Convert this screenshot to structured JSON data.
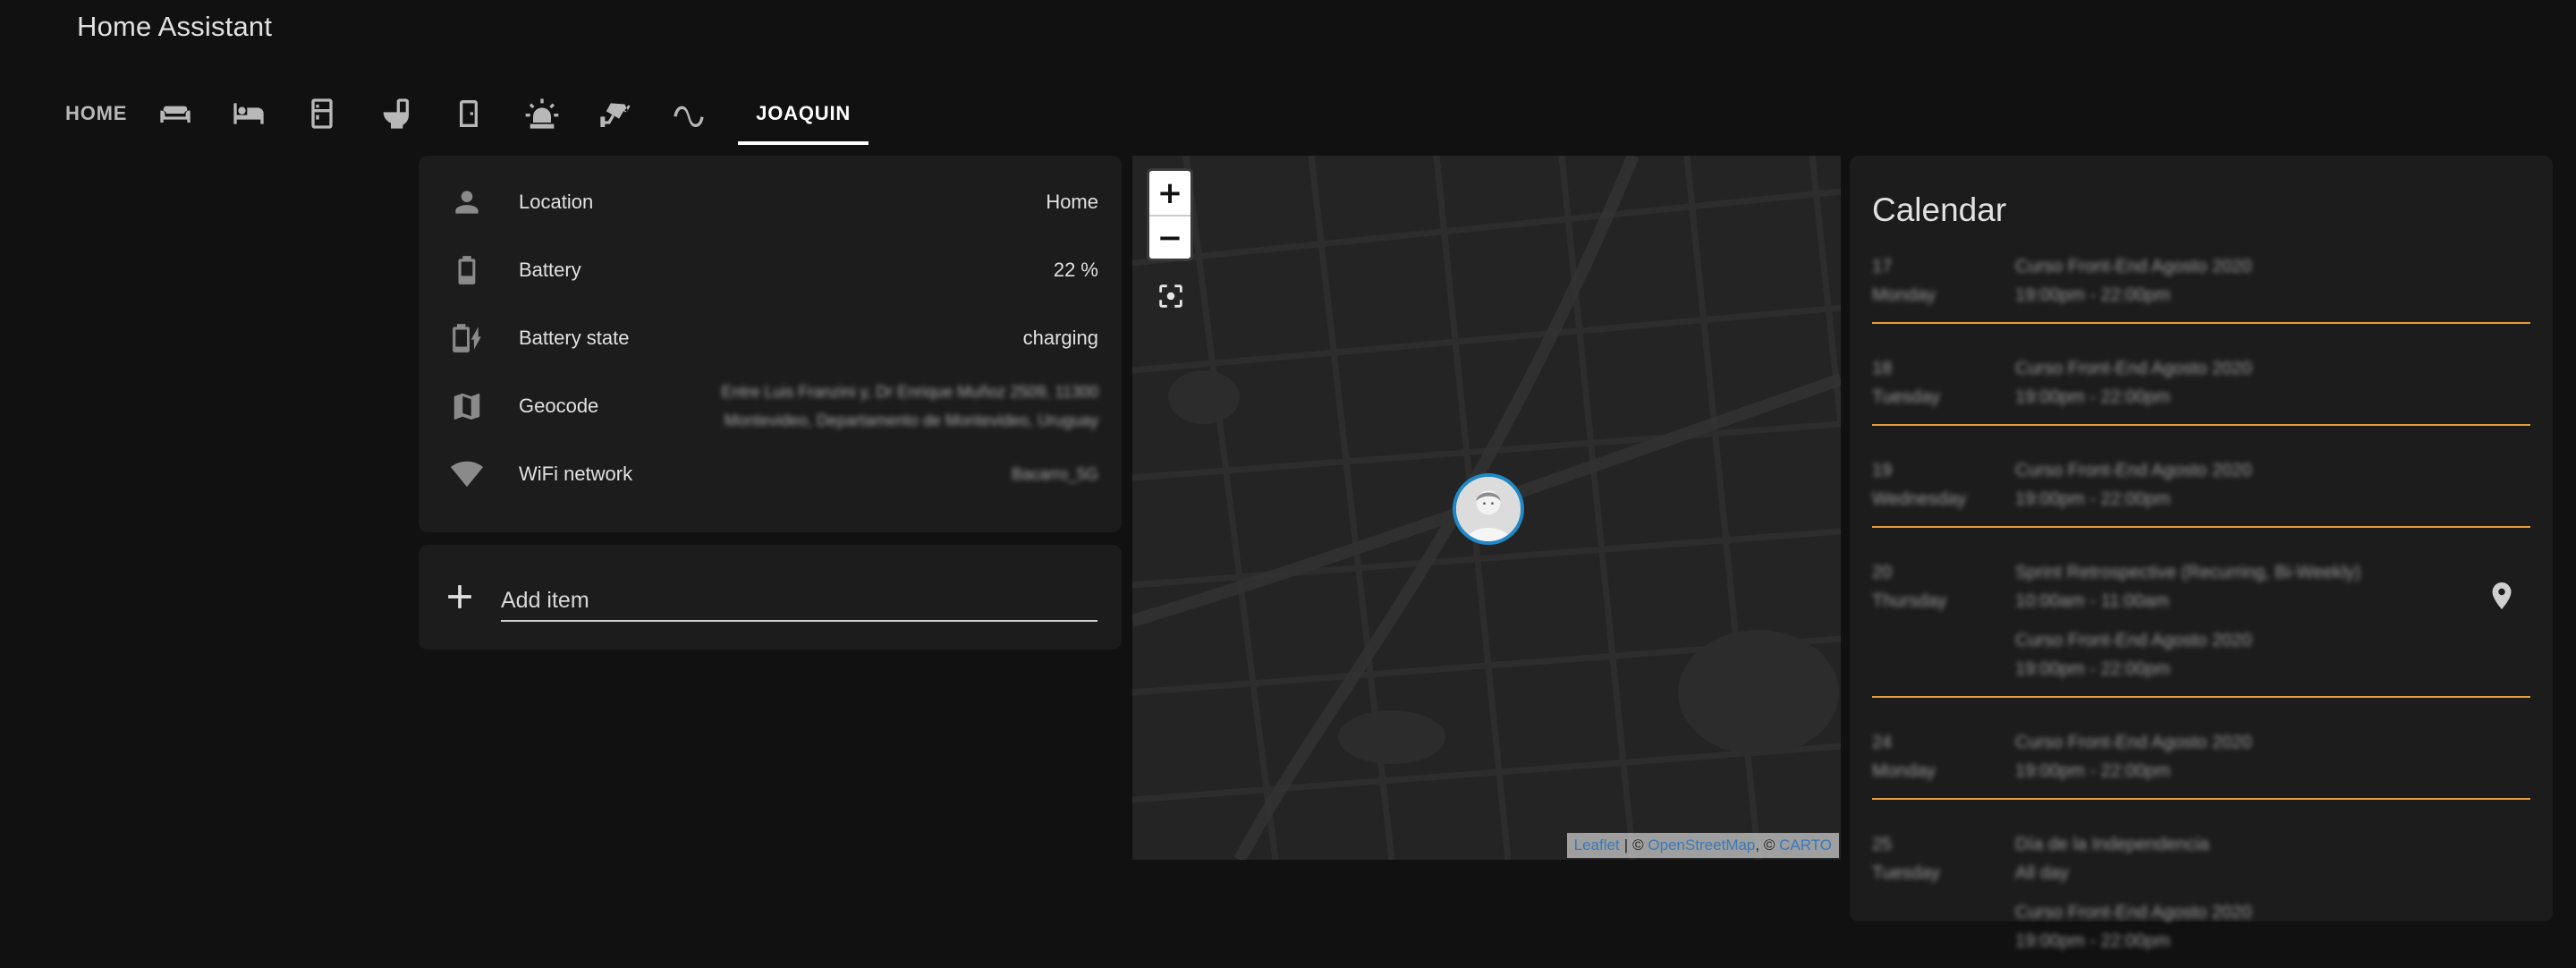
{
  "app": {
    "title": "Home Assistant"
  },
  "tabs": [
    {
      "label": "HOME",
      "type": "text"
    },
    {
      "icon": "sofa-icon",
      "type": "icon"
    },
    {
      "icon": "bed-icon",
      "type": "icon"
    },
    {
      "icon": "fridge-icon",
      "type": "icon"
    },
    {
      "icon": "toilet-icon",
      "type": "icon"
    },
    {
      "icon": "door-icon",
      "type": "icon"
    },
    {
      "icon": "alarm-light-icon",
      "type": "icon"
    },
    {
      "icon": "cctv-icon",
      "type": "icon"
    },
    {
      "icon": "sine-wave-icon",
      "type": "icon"
    },
    {
      "label": "JOAQUIN",
      "type": "text",
      "active": true
    }
  ],
  "entities": [
    {
      "icon": "account-icon",
      "name": "Location",
      "value": "Home"
    },
    {
      "icon": "battery-icon",
      "name": "Battery",
      "value": "22 %"
    },
    {
      "icon": "battery-charging-icon",
      "name": "Battery state",
      "value": "charging"
    },
    {
      "icon": "map-icon",
      "name": "Geocode",
      "value_line1": "Entre Luis Franzini y, Dr Enrique Muñoz 2509, 11300",
      "value_line2": "Montevideo, Departamento de Montevideo, Uruguay"
    },
    {
      "icon": "wifi-icon",
      "name": "WiFi network",
      "value": "Bacarro_5G"
    }
  ],
  "todo": {
    "placeholder": "Add item"
  },
  "map": {
    "zoom_in": "+",
    "zoom_out": "−",
    "attribution": {
      "leaflet": "Leaflet",
      "osm": "OpenStreetMap",
      "carto": "CARTO",
      "copyright": "©",
      "separator": "|"
    }
  },
  "calendar": {
    "title": "Calendar",
    "days": [
      {
        "day": "17",
        "weekday": "Monday",
        "events": [
          {
            "title": "Curso Front-End Agosto 2020",
            "time": "19:00pm - 22:00pm"
          }
        ]
      },
      {
        "day": "18",
        "weekday": "Tuesday",
        "events": [
          {
            "title": "Curso Front-End Agosto 2020",
            "time": "19:00pm - 22:00pm"
          }
        ]
      },
      {
        "day": "19",
        "weekday": "Wednesday",
        "events": [
          {
            "title": "Curso Front-End Agosto 2020",
            "time": "19:00pm - 22:00pm"
          }
        ]
      },
      {
        "day": "20",
        "weekday": "Thursday",
        "has_location": true,
        "events": [
          {
            "title": "Sprint Retrospective (Recurring, Bi-Weekly)",
            "time": "10:00am - 11:00am"
          },
          {
            "title": "Curso Front-End Agosto 2020",
            "time": "19:00pm - 22:00pm"
          }
        ]
      },
      {
        "day": "24",
        "weekday": "Monday",
        "events": [
          {
            "title": "Curso Front-End Agosto 2020",
            "time": "19:00pm - 22:00pm"
          }
        ]
      },
      {
        "day": "25",
        "weekday": "Tuesday",
        "events": [
          {
            "title": "Día de la Independencia",
            "time": "All day"
          },
          {
            "title": "Curso Front-End Agosto 2020",
            "time": "19:00pm - 22:00pm"
          }
        ]
      }
    ]
  },
  "colors": {
    "background": "#111111",
    "card": "#1c1c1c",
    "accent_divider": "#e59c3a",
    "marker_border": "#1e88c8"
  }
}
